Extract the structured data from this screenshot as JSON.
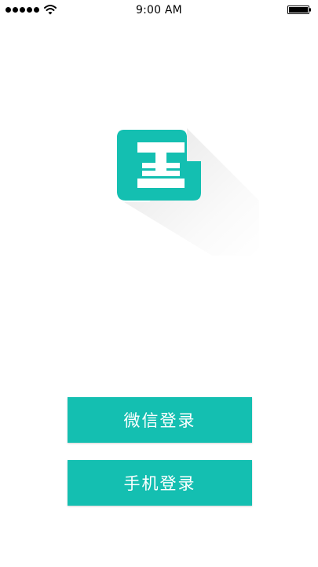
{
  "status_bar": {
    "time": "9:00 AM",
    "signal_icon": "signal-dots-icon",
    "wifi_icon": "wifi-icon",
    "battery_icon": "battery-icon"
  },
  "logo": {
    "icon": "app-logo-icon",
    "color": "#14bfb1"
  },
  "actions": {
    "wechat_login_label": "微信登录",
    "phone_login_label": "手机登录"
  },
  "colors": {
    "accent": "#14bfb1",
    "background": "#ffffff",
    "button_text": "#ffffff"
  }
}
